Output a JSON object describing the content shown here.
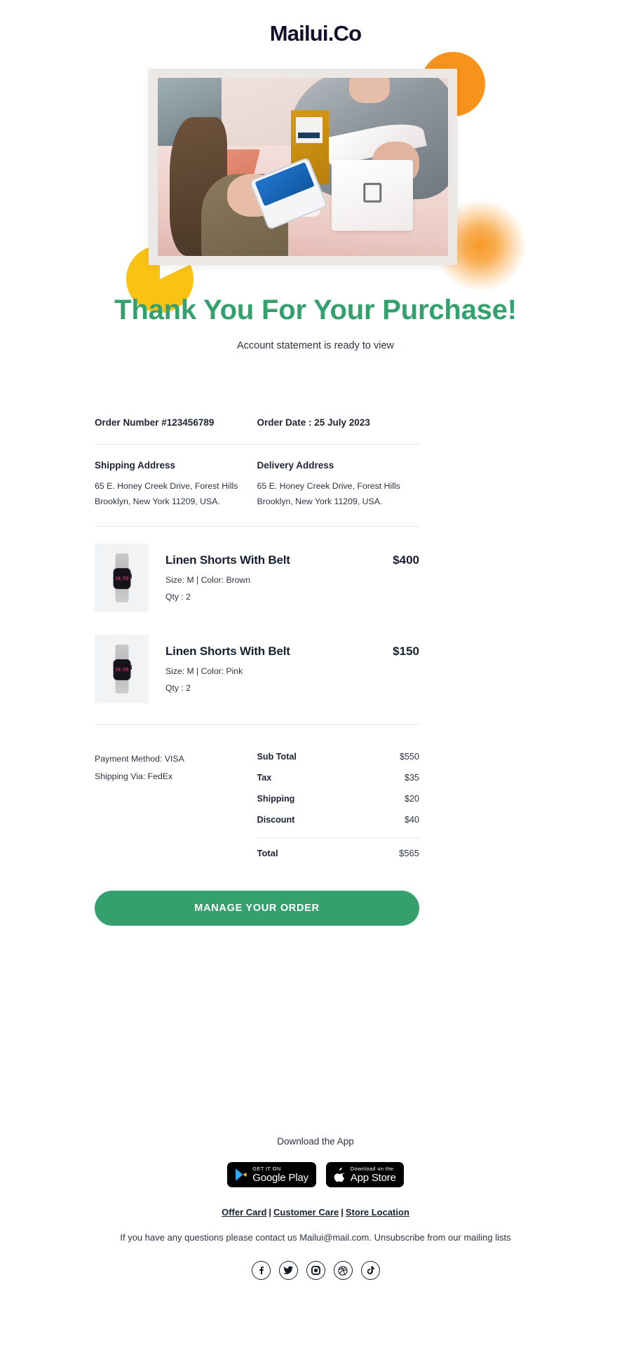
{
  "brand": {
    "logo_text": "Mailui.Co"
  },
  "hero": {
    "image_alt": "Customer paying with phone at a retail point-of-sale counter",
    "shape_orange_color": "#f7931a",
    "shape_yellow_color": "#fac213",
    "glow_color": "#f7931a"
  },
  "headline": {
    "title": "Thank You For Your Purchase!",
    "subtitle": "Account statement is ready to view",
    "accent_color": "#34a06d"
  },
  "order": {
    "number_label": "Order Number #123456789",
    "date_label": "Order Date : 25 July 2023"
  },
  "addresses": {
    "shipping": {
      "title": "Shipping Address",
      "line1": "65 E. Honey Creek Drive, Forest Hills",
      "line2": "Brooklyn, New York 11209, USA."
    },
    "delivery": {
      "title": "Delivery Address",
      "line1": "65 E. Honey Creek Drive, Forest Hills",
      "line2": "Brooklyn, New York 11209, USA."
    }
  },
  "items": [
    {
      "title": "Linen Shorts With Belt",
      "meta": "Size: M | Color: Brown",
      "qty": "Qty : 2",
      "price": "$400",
      "thumb_time": "14:59"
    },
    {
      "title": "Linen Shorts With Belt",
      "meta": "Size: M | Color: Pink",
      "qty": "Qty : 2",
      "price": "$150",
      "thumb_time": "14:59"
    }
  ],
  "payment": {
    "method": "Payment Method: VISA",
    "shipping_via": "Shipping Via: FedEx"
  },
  "totals": {
    "rows": [
      {
        "label": "Sub Total",
        "value": "$550"
      },
      {
        "label": "Tax",
        "value": "$35"
      },
      {
        "label": "Shipping",
        "value": "$20"
      },
      {
        "label": "Discount",
        "value": "$40"
      }
    ],
    "grand": {
      "label": "Total",
      "value": "$565"
    }
  },
  "cta": {
    "label": "MANAGE YOUR ORDER",
    "color": "#35a06e"
  },
  "footer": {
    "download_title": "Download the App",
    "badges": [
      {
        "name": "google-play-badge",
        "small": "GET IT ON",
        "big": "Google Play"
      },
      {
        "name": "app-store-badge",
        "small": "Download on the",
        "big": "App Store"
      }
    ],
    "links": [
      {
        "label": "Offer Card"
      },
      {
        "label": "Customer Care"
      },
      {
        "label": "Store Location"
      }
    ],
    "link_separator": "|",
    "contact_text": "If you have any questions please contact us Mailui@mail.com. Unsubscribe from our mailing lists",
    "socials": [
      {
        "name": "facebook-icon"
      },
      {
        "name": "twitter-icon"
      },
      {
        "name": "instagram-icon"
      },
      {
        "name": "dribbble-icon"
      },
      {
        "name": "tiktok-icon"
      }
    ]
  }
}
